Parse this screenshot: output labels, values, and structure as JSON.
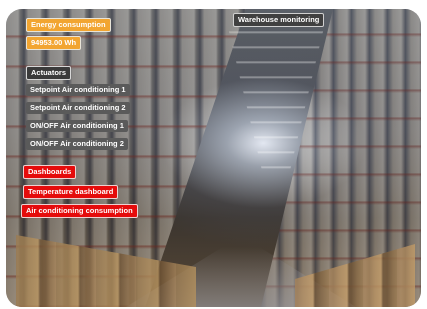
{
  "header": {
    "energy_label": "Energy consumption",
    "energy_value": "94953.00 Wh",
    "title": "Warehouse monitoring"
  },
  "actuators": {
    "heading": "Actuators",
    "items": [
      "Setpoint Air conditioning 1",
      "Setpoint Air conditioning 2",
      "ON/OFF Air conditioning 1",
      "ON/OFF Air conditioning 2"
    ]
  },
  "dashboards": {
    "heading": "Dashboards",
    "items": [
      "Temperature dashboard",
      "Air conditioning consumption"
    ]
  },
  "colors": {
    "accent_orange": "#f2a531",
    "accent_red": "#e50b0b",
    "label_dark": "#3b3b3b"
  }
}
